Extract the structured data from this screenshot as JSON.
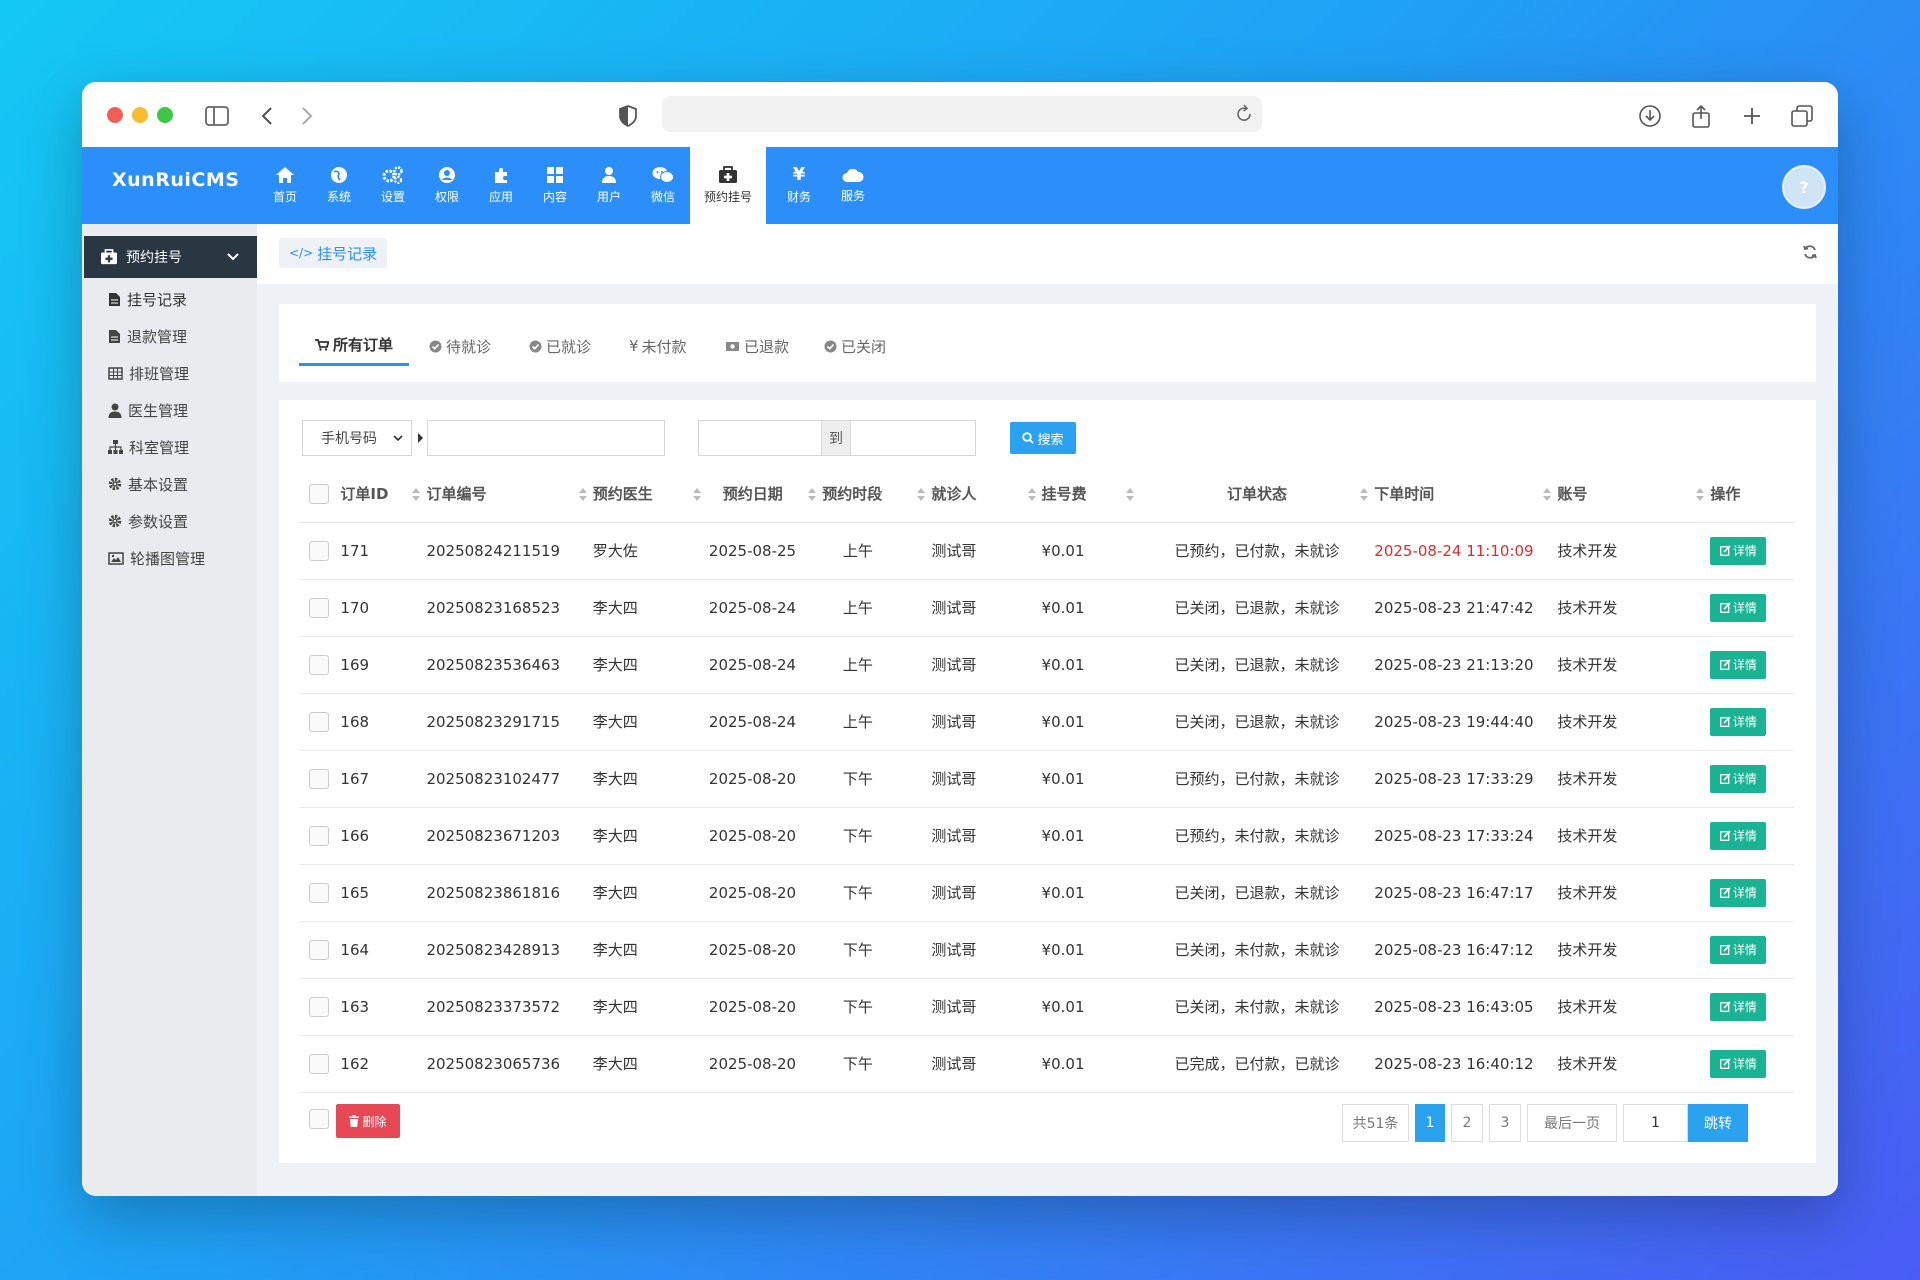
{
  "nav": {
    "logo": "XunRuiCMS",
    "items": [
      {
        "label": "首页",
        "icon": "home-icon"
      },
      {
        "label": "系统",
        "icon": "globe-icon"
      },
      {
        "label": "设置",
        "icon": "cogs-icon"
      },
      {
        "label": "权限",
        "icon": "user-circle-icon"
      },
      {
        "label": "应用",
        "icon": "puzzle-icon"
      },
      {
        "label": "内容",
        "icon": "grid-icon"
      },
      {
        "label": "用户",
        "icon": "user-icon"
      },
      {
        "label": "微信",
        "icon": "wechat-icon"
      },
      {
        "label": "预约挂号",
        "icon": "medkit-icon"
      },
      {
        "label": "财务",
        "icon": "yen-icon"
      },
      {
        "label": "服务",
        "icon": "cloud-icon"
      }
    ],
    "active": "预约挂号"
  },
  "sidebar": {
    "header": "预约挂号",
    "items": [
      {
        "label": "挂号记录",
        "icon": "file-icon"
      },
      {
        "label": "退款管理",
        "icon": "file-icon"
      },
      {
        "label": "排班管理",
        "icon": "table-icon"
      },
      {
        "label": "医生管理",
        "icon": "user-md-icon"
      },
      {
        "label": "科室管理",
        "icon": "sitemap-icon"
      },
      {
        "label": "基本设置",
        "icon": "gear-icon"
      },
      {
        "label": "参数设置",
        "icon": "gear-icon"
      },
      {
        "label": "轮播图管理",
        "icon": "image-icon"
      }
    ]
  },
  "breadcrumb": "挂号记录",
  "tabs": [
    "所有订单",
    "待就诊",
    "已就诊",
    "未付款",
    "已退款",
    "已关闭"
  ],
  "filter": {
    "field_select": "手机号码",
    "to_label": "到",
    "search_label": "搜索"
  },
  "table": {
    "headers": [
      "订单ID",
      "订单编号",
      "预约医生",
      "预约日期",
      "预约时段",
      "就诊人",
      "挂号费",
      "订单状态",
      "下单时间",
      "账号",
      "操作"
    ],
    "detail_label": "详情",
    "rows": [
      {
        "id": "171",
        "no": "20250824211519",
        "doctor": "罗大佐",
        "date": "2025-08-25",
        "slot": "上午",
        "patient": "测试哥",
        "fee": "¥0.01",
        "status": "已预约，已付款，未就诊",
        "time": "2025-08-24 11:10:09",
        "account": "技术开发",
        "highlight": true
      },
      {
        "id": "170",
        "no": "20250823168523",
        "doctor": "李大四",
        "date": "2025-08-24",
        "slot": "上午",
        "patient": "测试哥",
        "fee": "¥0.01",
        "status": "已关闭，已退款，未就诊",
        "time": "2025-08-23 21:47:42",
        "account": "技术开发",
        "highlight": false
      },
      {
        "id": "169",
        "no": "20250823536463",
        "doctor": "李大四",
        "date": "2025-08-24",
        "slot": "上午",
        "patient": "测试哥",
        "fee": "¥0.01",
        "status": "已关闭，已退款，未就诊",
        "time": "2025-08-23 21:13:20",
        "account": "技术开发",
        "highlight": false
      },
      {
        "id": "168",
        "no": "20250823291715",
        "doctor": "李大四",
        "date": "2025-08-24",
        "slot": "上午",
        "patient": "测试哥",
        "fee": "¥0.01",
        "status": "已关闭，已退款，未就诊",
        "time": "2025-08-23 19:44:40",
        "account": "技术开发",
        "highlight": false
      },
      {
        "id": "167",
        "no": "20250823102477",
        "doctor": "李大四",
        "date": "2025-08-20",
        "slot": "下午",
        "patient": "测试哥",
        "fee": "¥0.01",
        "status": "已预约，已付款，未就诊",
        "time": "2025-08-23 17:33:29",
        "account": "技术开发",
        "highlight": false
      },
      {
        "id": "166",
        "no": "20250823671203",
        "doctor": "李大四",
        "date": "2025-08-20",
        "slot": "下午",
        "patient": "测试哥",
        "fee": "¥0.01",
        "status": "已预约，未付款，未就诊",
        "time": "2025-08-23 17:33:24",
        "account": "技术开发",
        "highlight": false
      },
      {
        "id": "165",
        "no": "20250823861816",
        "doctor": "李大四",
        "date": "2025-08-20",
        "slot": "下午",
        "patient": "测试哥",
        "fee": "¥0.01",
        "status": "已关闭，已退款，未就诊",
        "time": "2025-08-23 16:47:17",
        "account": "技术开发",
        "highlight": false
      },
      {
        "id": "164",
        "no": "20250823428913",
        "doctor": "李大四",
        "date": "2025-08-20",
        "slot": "下午",
        "patient": "测试哥",
        "fee": "¥0.01",
        "status": "已关闭，未付款，未就诊",
        "time": "2025-08-23 16:47:12",
        "account": "技术开发",
        "highlight": false
      },
      {
        "id": "163",
        "no": "20250823373572",
        "doctor": "李大四",
        "date": "2025-08-20",
        "slot": "下午",
        "patient": "测试哥",
        "fee": "¥0.01",
        "status": "已关闭，未付款，未就诊",
        "time": "2025-08-23 16:43:05",
        "account": "技术开发",
        "highlight": false
      },
      {
        "id": "162",
        "no": "20250823065736",
        "doctor": "李大四",
        "date": "2025-08-20",
        "slot": "下午",
        "patient": "测试哥",
        "fee": "¥0.01",
        "status": "已完成，已付款，已就诊",
        "time": "2025-08-23 16:40:12",
        "account": "技术开发",
        "highlight": false
      }
    ]
  },
  "footer": {
    "delete_label": "删除",
    "total": "共51条",
    "pages": [
      "1",
      "2",
      "3"
    ],
    "current_page": "1",
    "last_label": "最后一页",
    "jump_value": "1",
    "jump_label": "跳转"
  },
  "colors": {
    "nav_blue": "#2c8ef8",
    "detail_green": "#1ab394",
    "delete_red": "#e74856",
    "highlight_red": "#e12a2a"
  }
}
